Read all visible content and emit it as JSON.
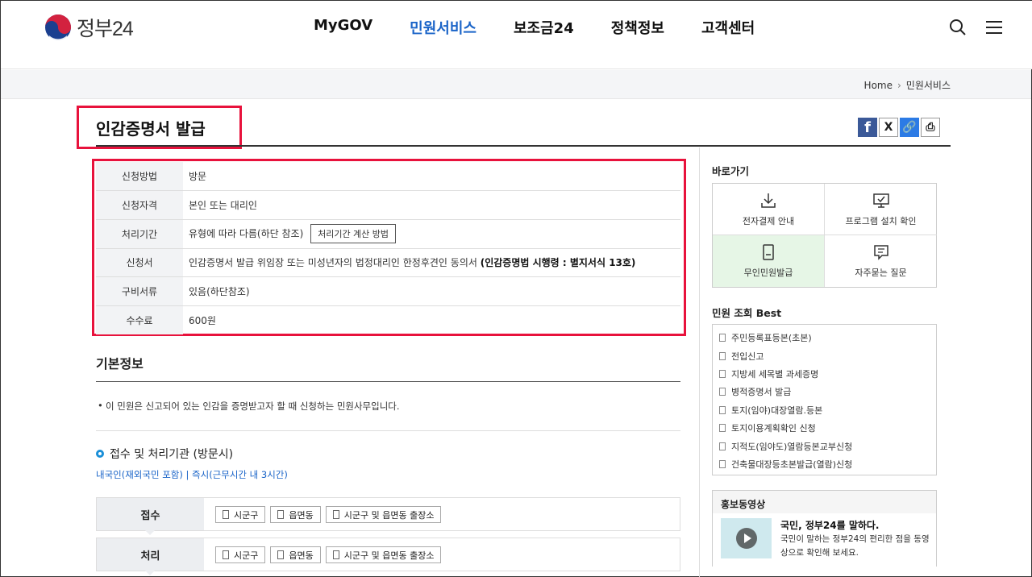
{
  "header": {
    "logo_text": "정부24",
    "nav": [
      "MyGOV",
      "민원서비스",
      "보조금24",
      "정책정보",
      "고객센터"
    ],
    "active_nav": 1
  },
  "breadcrumb": {
    "home": "Home",
    "current": "민원서비스"
  },
  "page_title": "인감증명서 발급",
  "share": {
    "facebook": "f",
    "x": "X",
    "link": "🔗",
    "print": "⎙"
  },
  "info": {
    "rows": [
      {
        "label": "신청방법",
        "value": "방문"
      },
      {
        "label": "신청자격",
        "value": "본인 또는 대리인"
      },
      {
        "label": "처리기간",
        "value": "유형에 따라 다름(하단 참조)",
        "button": "처리기간 계산 방법"
      },
      {
        "label": "신청서",
        "value": "인감증명서 발급 위임장 또는 미성년자의 법정대리인 한정후견인 동의서 ",
        "bold": "(인감증명법 시행령 : 별지서식 13호)"
      },
      {
        "label": "구비서류",
        "value": "있음(하단참조)"
      },
      {
        "label": "수수료",
        "value": "600원"
      }
    ]
  },
  "basic": {
    "title": "기본정보",
    "desc": "이 민원은 신고되어 있는 인감을 증명받고자 할 때 신청하는 민원사무입니다.",
    "sub_title": "접수 및 처리기관 (방문시)",
    "sub_link": "내국인(재외국민 포함) | 즉시(근무시간 내 3시간)",
    "receive_label": "접수",
    "process_label": "처리",
    "tags": [
      "시군구",
      "읍면동",
      "시군구 및 읍면동 출장소"
    ]
  },
  "sidebar": {
    "quick_title": "바로가기",
    "quick": [
      "전자결제 안내",
      "프로그램 설치 확인",
      "무인민원발급",
      "자주묻는 질문"
    ],
    "best_title": "민원 조회 Best",
    "best": [
      "주민등록표등본(초본)",
      "전입신고",
      "지방세 세목별 과세증명",
      "병적증명서 발급",
      "토지(임야)대장열람.등본",
      "토지이용계획확인 신청",
      "지적도(임야도)열람등본교부신청",
      "건축물대장등초본발급(열람)신청"
    ],
    "promo_title": "홍보동영상",
    "promo_headline": "국민, 정부24를 말하다.",
    "promo_desc": "국민이 말하는 정부24의 편리한 점을 동영상으로 확인해 보세요."
  },
  "colors": {
    "accent": "#1a64c8",
    "highlight": "#e8123c",
    "quick_hl": "#e6f6e6"
  }
}
